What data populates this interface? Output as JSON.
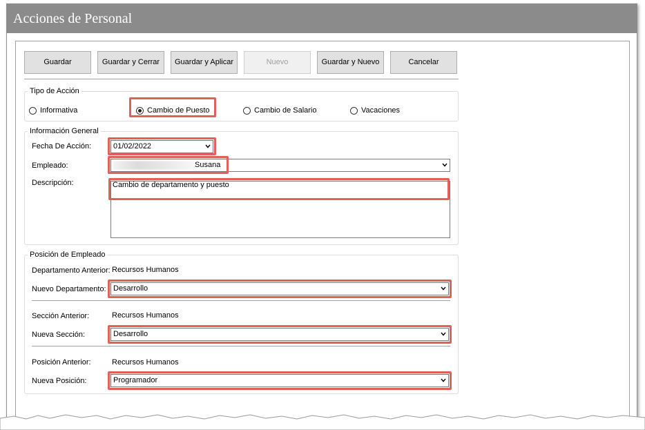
{
  "window": {
    "title": "Acciones de Personal"
  },
  "toolbar": {
    "guardar": "Guardar",
    "guardar_cerrar": "Guardar y Cerrar",
    "guardar_aplicar": "Guardar y Aplicar",
    "nuevo": "Nuevo",
    "guardar_nuevo": "Guardar y Nuevo",
    "cancelar": "Cancelar"
  },
  "tipo_accion": {
    "label": "Tipo de Acción",
    "options": [
      "Informativa",
      "Cambio de Puesto",
      "Cambio de Salario",
      "Vacaciones"
    ],
    "selected": "Cambio de Puesto"
  },
  "info_general": {
    "label": "Información General",
    "fecha_label": "Fecha De Acción:",
    "fecha_value": "01/02/2022",
    "empleado_label": "Empleado:",
    "empleado_value": "Susana",
    "descripcion_label": "Descripción:",
    "descripcion_value": "Cambio de departamento y puesto"
  },
  "posicion": {
    "label": "Posición de Empleado",
    "depto_anterior_label": "Departamento Anterior:",
    "depto_anterior_value": "Recursos Humanos",
    "nuevo_depto_label": "Nuevo Departamento:",
    "nuevo_depto_value": "Desarrollo",
    "seccion_anterior_label": "Sección Anterior:",
    "seccion_anterior_value": "Recursos Humanos",
    "nueva_seccion_label": "Nueva Sección:",
    "nueva_seccion_value": "Desarrollo",
    "posicion_anterior_label": "Posición Anterior:",
    "posicion_anterior_value": "Recursos Humanos",
    "nueva_posicion_label": "Nueva Posición:",
    "nueva_posicion_value": "Programador"
  },
  "colors": {
    "titlebar": "#8b8b8b",
    "highlight": "#e0605a",
    "button": "#e1e1e1"
  }
}
